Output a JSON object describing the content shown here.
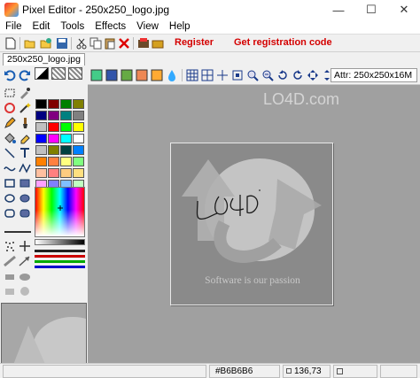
{
  "window": {
    "title": "Pixel Editor - 250x250_logo.jpg",
    "minimize": "—",
    "maximize": "☐",
    "close": "✕"
  },
  "menu": [
    "File",
    "Edit",
    "Tools",
    "Effects",
    "View",
    "Help"
  ],
  "toolbar": {
    "register_label": "Register",
    "get_code_label": "Get registration code"
  },
  "tabs": [
    {
      "label": "250x250_logo.jpg"
    }
  ],
  "attr": "Attr:   250x250x16M",
  "canvas": {
    "caption": "Software is our passion",
    "handwriting": "LO4D"
  },
  "watermark": "LO4D.com",
  "status": {
    "color_value": "#B6B6B6",
    "coords": "136,73"
  },
  "colors": {
    "register": "#d40000",
    "workspace": "#a0a0a0"
  },
  "palette": [
    [
      "#000000",
      "#800000",
      "#008000",
      "#808000"
    ],
    [
      "#000080",
      "#800080",
      "#008080",
      "#808080"
    ],
    [
      "#c0c0c0",
      "#ff0000",
      "#00ff00",
      "#ffff00"
    ],
    [
      "#0000ff",
      "#ff00ff",
      "#00ffff",
      "#ffffff"
    ],
    [
      "#c0c0c0",
      "#808000",
      "#004040",
      "#0080ff"
    ],
    [
      "#ff8000",
      "#ff8040",
      "#ffff80",
      "#80ff80"
    ],
    [
      "#ffc0a0",
      "#ff8080",
      "#ffcc80",
      "#ffe080"
    ],
    [
      "#ffa0ff",
      "#8080ff",
      "#80c0ff",
      "#c0ffc0"
    ]
  ],
  "icons": {
    "new": "new-file-icon",
    "open": "open-folder-icon",
    "save": "save-icon",
    "cut": "cut-icon",
    "copy": "copy-icon",
    "paste": "paste-icon",
    "delete": "delete-icon"
  }
}
